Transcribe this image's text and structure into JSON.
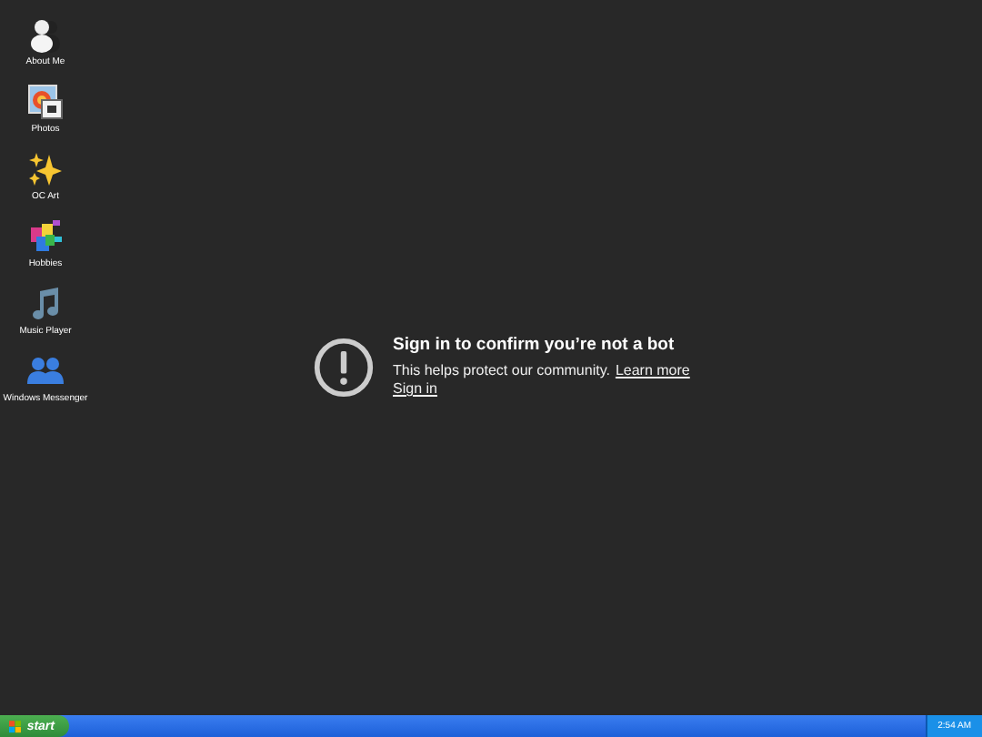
{
  "desktop_icons": [
    {
      "label": "About Me",
      "kind": "person"
    },
    {
      "label": "Photos",
      "kind": "photos"
    },
    {
      "label": "OC Art",
      "kind": "sparkles"
    },
    {
      "label": "Hobbies",
      "kind": "blocks"
    },
    {
      "label": "Music Player",
      "kind": "music"
    },
    {
      "label": "Windows Messenger",
      "kind": "people"
    }
  ],
  "notice": {
    "title": "Sign in to confirm you’re not a bot",
    "text": "This helps protect our community.",
    "link": "Learn more",
    "sign_in": "Sign in"
  },
  "taskbar": {
    "start": "start",
    "clock": "2:54 AM"
  }
}
